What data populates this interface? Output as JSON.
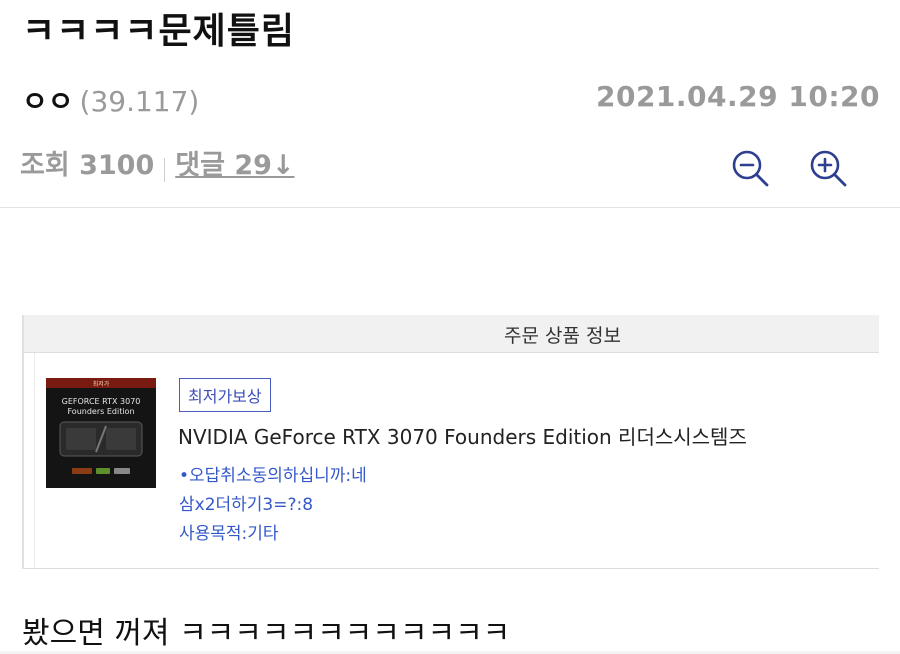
{
  "post": {
    "title": "ㅋㅋㅋㅋ문제틀림",
    "author": "ㅇㅇ",
    "author_ip": "(39.117)",
    "datetime": "2021.04.29 10:20",
    "views": "조회 3100",
    "comments": "댓글 29↓",
    "body": "봤으면 꺼져 ㅋㅋㅋㅋㅋㅋㅋㅋㅋㅋㅋㅋ"
  },
  "toolbar": {
    "zoom_out_icon": "zoom-out-icon",
    "zoom_in_icon": "zoom-in-icon"
  },
  "order": {
    "header": "주문 상품 정보",
    "badge": "최저가보상",
    "product_name": "NVIDIA GeForce RTX 3070 Founders Edition 리더스시스템즈",
    "options": [
      "•오답취소동의하십니까:네",
      "삼x2더하기3=?:8",
      "사용목적:기타"
    ],
    "image": {
      "top_text": "최저가",
      "line1": "GEFORCE RTX 3070",
      "line2": "Founders Edition"
    }
  },
  "colors": {
    "accent": "#2e3f8f",
    "option_text": "#3558c9",
    "muted": "#9a9a9a"
  }
}
